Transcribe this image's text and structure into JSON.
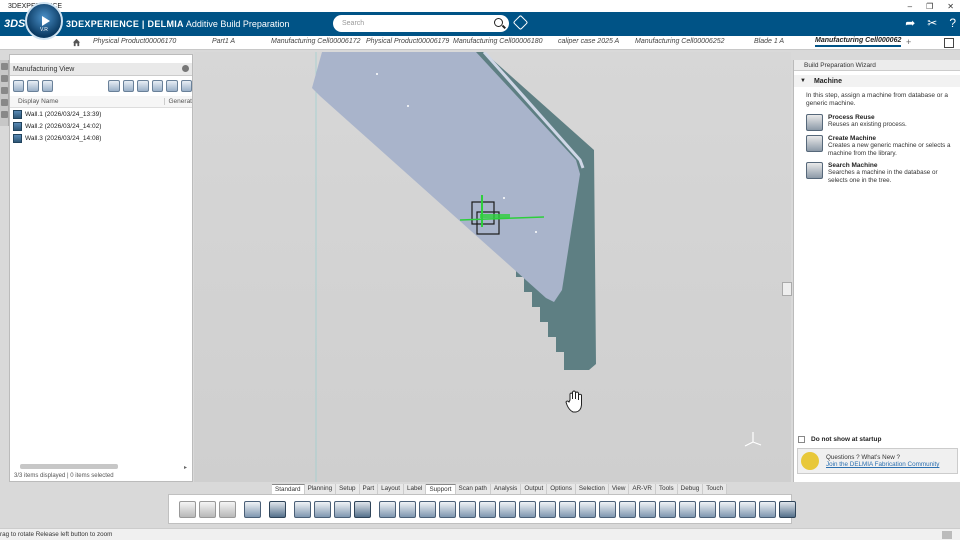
{
  "window": {
    "title": "3DEXPERIENCE"
  },
  "header": {
    "brand_prefix": "3DEXPERIENCE | DELMIA",
    "brand_app": "Additive Build Preparation",
    "compass_version": "V.R",
    "search_placeholder": "Search"
  },
  "tabs": [
    {
      "label": "Physical Product00006170",
      "active": false
    },
    {
      "label": "Part1 A",
      "active": false
    },
    {
      "label": "Manufacturing Cell00006172",
      "active": false
    },
    {
      "label": "Physical Product00006179",
      "active": false
    },
    {
      "label": "Manufacturing Cell00006180",
      "active": false
    },
    {
      "label": "caliper case 2025 A",
      "active": false
    },
    {
      "label": "Manufacturing Cell00006252",
      "active": false
    },
    {
      "label": "Blade 1 A",
      "active": false
    },
    {
      "label": "Manufacturing Cell000062",
      "active": true
    }
  ],
  "manufacturing_view": {
    "title": "Manufacturing View",
    "columns": [
      "Display Name",
      "Generat"
    ],
    "rows": [
      "Wall.1 (2026/03/24_13:39)",
      "Wall.2 (2026/03/24_14:02)",
      "Wall.3 (2026/03/24_14:08)"
    ],
    "status": "3/3 items displayed | 0 items selected"
  },
  "wizard": {
    "title": "Build Preparation Wizard",
    "section": "Machine",
    "intro": "In this step, assign a machine from database or a generic machine.",
    "options": [
      {
        "title": "Process Reuse",
        "desc": "Reuses an existing process."
      },
      {
        "title": "Create Machine",
        "desc": "Creates a new generic machine or selects a machine from the library."
      },
      {
        "title": "Search Machine",
        "desc": "Searches a machine in the database or selects one in the tree."
      }
    ],
    "dont_show": "Do not show at startup",
    "questions": "Questions ? What's New ?",
    "community_link": "Join the DELMIA Fabrication Community"
  },
  "command_tabs": [
    "Standard",
    "Planning",
    "Setup",
    "Part",
    "Layout",
    "Label",
    "Support",
    "Scan path",
    "Analysis",
    "Output",
    "Options",
    "Selection",
    "View",
    "AR-VR",
    "Tools",
    "Debug",
    "Touch"
  ],
  "active_command_tab": "Support",
  "statusbar": {
    "text": "rag to rotate  Release left button to zoom"
  },
  "colors": {
    "header": "#005386",
    "accent": "#2a6fb0",
    "part_face": "#aab6cc",
    "part_side": "#5d7f83"
  }
}
